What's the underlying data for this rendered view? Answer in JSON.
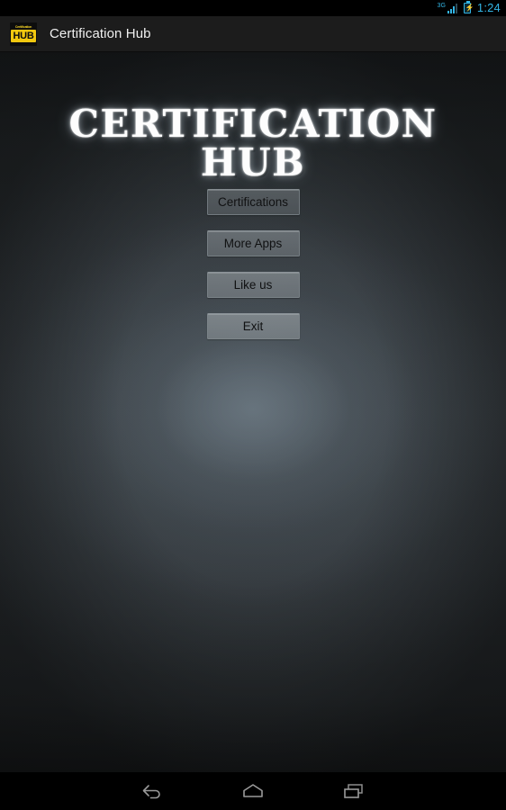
{
  "status_bar": {
    "network_type": "3G",
    "signal_icon": "signal-bars-icon",
    "battery_icon": "battery-charging-icon",
    "clock": "1:24"
  },
  "action_bar": {
    "app_icon": "certification-hub-app-icon",
    "icon_top_text": "Certification",
    "icon_main_text": "HUB",
    "title": "Certification Hub"
  },
  "splash": {
    "title_line1": "CERTIFICATION",
    "title_line2": "HUB",
    "buttons": [
      {
        "label": "Certifications",
        "name": "certifications-button"
      },
      {
        "label": "More Apps",
        "name": "more-apps-button"
      },
      {
        "label": "Like us",
        "name": "like-us-button"
      },
      {
        "label": "Exit",
        "name": "exit-button"
      }
    ]
  },
  "nav_bar": {
    "back": "back-icon",
    "home": "home-icon",
    "recents": "recents-icon"
  },
  "colors": {
    "accent_blue": "#33b5e5",
    "brand_yellow": "#f2c80f",
    "action_bar_bg": "#1c1c1c",
    "content_bg": "#2b2f32",
    "nav_bar_bg": "#000000"
  }
}
